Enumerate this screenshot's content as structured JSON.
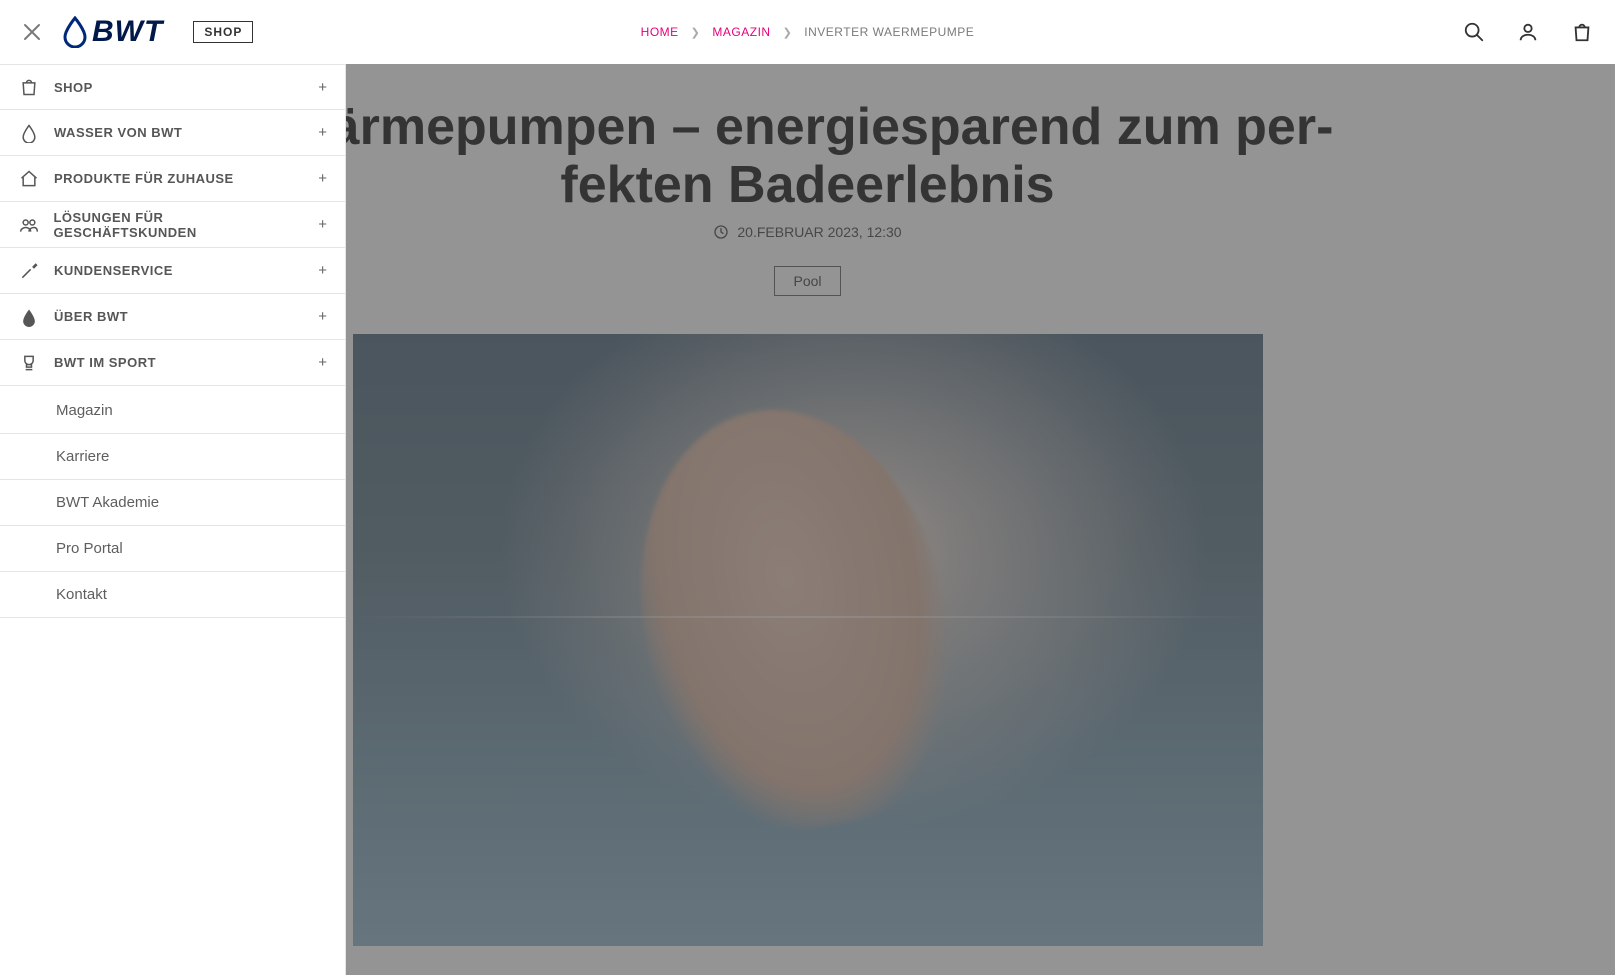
{
  "header": {
    "logo_glyph": "b",
    "logo_text": "BWT",
    "shop_pill": "SHOP"
  },
  "breadcrumb": {
    "items": [
      {
        "label": "HOME",
        "link": true
      },
      {
        "label": "MAGAZIN",
        "link": true
      },
      {
        "label": "INVERTER WAERMEPUMPE",
        "link": false
      }
    ]
  },
  "sidebar": {
    "primary": [
      {
        "icon": "bag",
        "label": "SHOP"
      },
      {
        "icon": "drop",
        "label": "WASSER VON BWT"
      },
      {
        "icon": "home",
        "label": "PRODUKTE FÜR ZUHAUSE"
      },
      {
        "icon": "people",
        "label": "LÖSUNGEN FÜR GESCHÄFTSKUNDEN"
      },
      {
        "icon": "tools",
        "label": "KUNDENSERVICE"
      },
      {
        "icon": "bwt",
        "label": "ÜBER BWT"
      },
      {
        "icon": "trophy",
        "label": "BWT IM SPORT"
      }
    ],
    "secondary": [
      {
        "label": "Magazin"
      },
      {
        "label": "Karriere"
      },
      {
        "label": "BWT Akademie"
      },
      {
        "label": "Pro Portal"
      },
      {
        "label": "Kontakt"
      }
    ]
  },
  "article": {
    "title_line1": "Wärmepumpen – energiesparend zum per-",
    "title_line2": "fekten Badeerlebnis",
    "date": "20.FEBRUAR 2023, 12:30",
    "tag": "Pool"
  }
}
